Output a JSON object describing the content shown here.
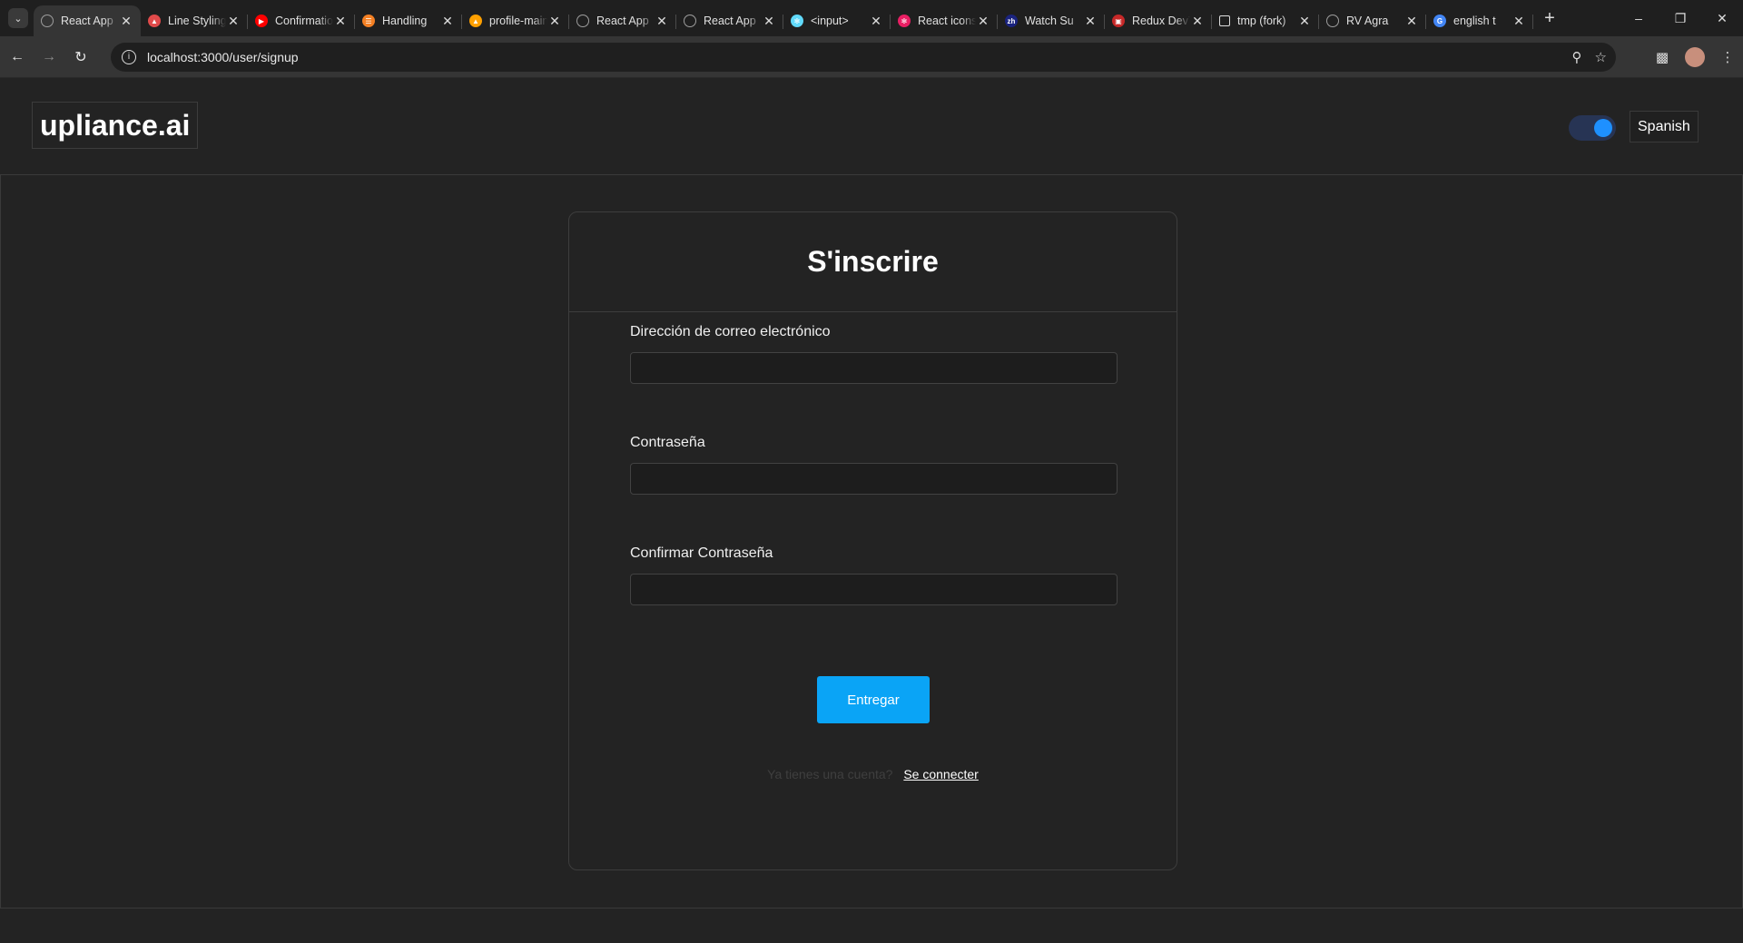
{
  "browser": {
    "tabs": [
      {
        "title": "React App",
        "icon": "globe-icon",
        "color": "#9e9e9e"
      },
      {
        "title": "Line Styling",
        "icon": "shield-icon",
        "color": "#e04a4a"
      },
      {
        "title": "Confirmation",
        "icon": "youtube-icon",
        "color": "#ff0000"
      },
      {
        "title": "Handling",
        "icon": "stackoverflow-icon",
        "color": "#f48024"
      },
      {
        "title": "profile-main",
        "icon": "firebase-icon",
        "color": "#ffa000"
      },
      {
        "title": "React App",
        "icon": "globe-icon",
        "color": "#9e9e9e"
      },
      {
        "title": "React App",
        "icon": "globe-icon",
        "color": "#9e9e9e"
      },
      {
        "title": "<input>",
        "icon": "react-icon",
        "color": "#61dafb"
      },
      {
        "title": "React icons",
        "icon": "react-icon",
        "color": "#e91e63"
      },
      {
        "title": "Watch Su",
        "icon": "zh-icon",
        "color": "#1a237e"
      },
      {
        "title": "Redux DevTools",
        "icon": "image-icon",
        "color": "#c62828"
      },
      {
        "title": "tmp (fork)",
        "icon": "square-icon",
        "color": "#dddddd"
      },
      {
        "title": "RV Agra",
        "icon": "globe-icon",
        "color": "#9e9e9e"
      },
      {
        "title": "english t",
        "icon": "google-icon",
        "color": "#4285f4"
      }
    ],
    "url": "localhost:3000/user/signup"
  },
  "header": {
    "logo": "upliance.ai",
    "language_button": "Spanish",
    "theme_toggle_on": true
  },
  "signup": {
    "title": "S'inscrire",
    "email_label": "Dirección de correo electrónico",
    "email_value": "",
    "password_label": "Contraseña",
    "password_value": "",
    "confirm_label": "Confirmar Contraseña",
    "confirm_value": "",
    "submit_label": "Entregar",
    "have_account_text": "Ya tienes una cuenta?",
    "login_link": "Se connecter"
  }
}
